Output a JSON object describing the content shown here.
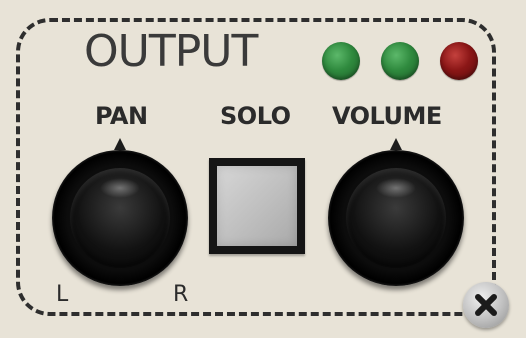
{
  "panel": {
    "title": "OUTPUT",
    "leds": [
      {
        "name": "led-1",
        "color": "#2f8a3e"
      },
      {
        "name": "led-2",
        "color": "#2f8a3e"
      },
      {
        "name": "led-3",
        "color": "#8a1616"
      }
    ],
    "pan_label": "PAN",
    "solo_label": "SOLO",
    "volume_label": "VOLUME",
    "pan_left": "L",
    "pan_right": "R",
    "icons": {
      "screw": "screw-icon",
      "pointer": "pointer-icon"
    }
  }
}
